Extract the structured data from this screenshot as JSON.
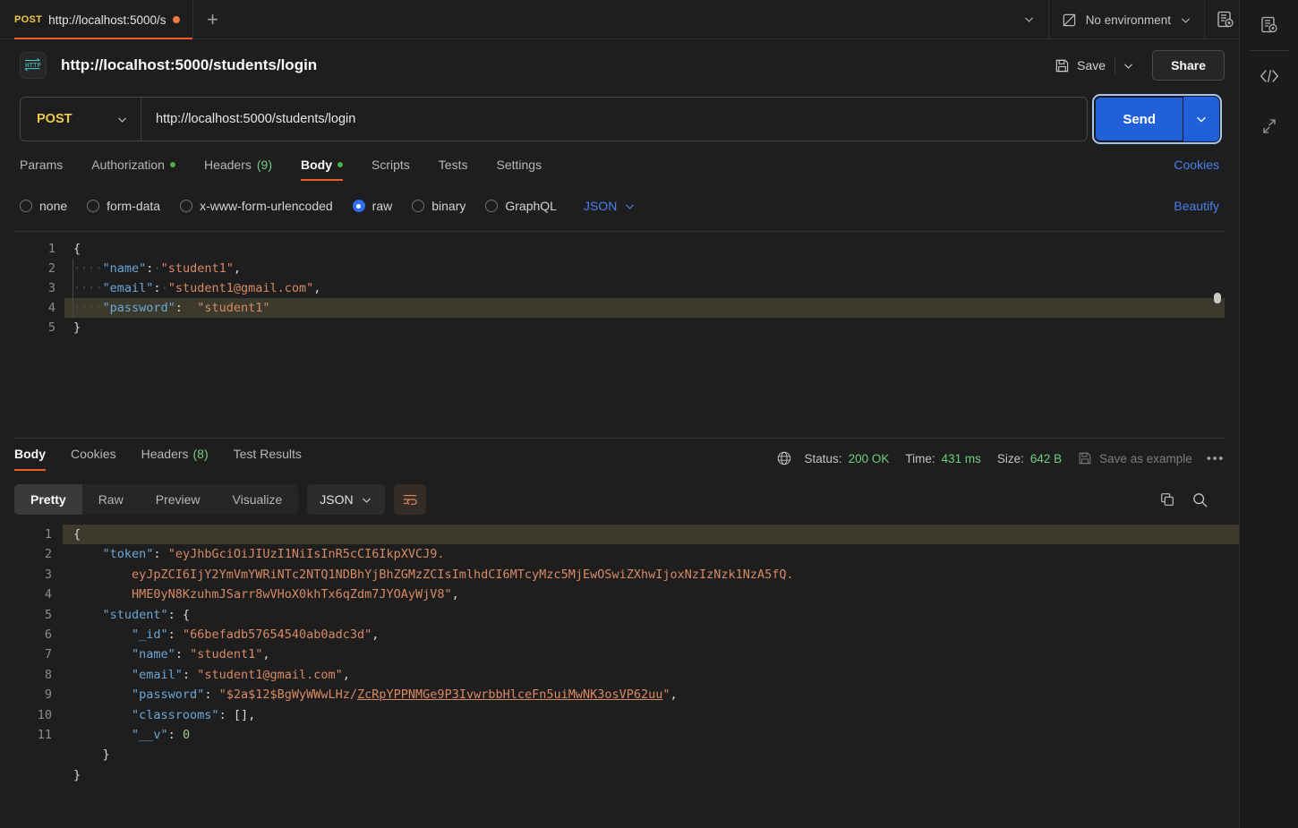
{
  "tabbar": {
    "tab_method": "POST",
    "tab_title": "http://localhost:5000/s",
    "plus": "+",
    "env_label": "No environment",
    "caret": "⌄"
  },
  "request_header": {
    "protocol_badge": "HTTP",
    "title": "http://localhost:5000/students/login",
    "save_label": "Save",
    "share_label": "Share"
  },
  "url_bar": {
    "method": "POST",
    "url": "http://localhost:5000/students/login",
    "send_label": "Send"
  },
  "request_tabs": {
    "items": [
      {
        "label": "Params",
        "dot": false,
        "count": ""
      },
      {
        "label": "Authorization",
        "dot": true,
        "count": ""
      },
      {
        "label": "Headers",
        "dot": false,
        "count": "(9)"
      },
      {
        "label": "Body",
        "dot": true,
        "count": ""
      },
      {
        "label": "Scripts",
        "dot": false,
        "count": ""
      },
      {
        "label": "Tests",
        "dot": false,
        "count": ""
      },
      {
        "label": "Settings",
        "dot": false,
        "count": ""
      }
    ],
    "active": "Body",
    "cookies_label": "Cookies"
  },
  "body_type": {
    "options": [
      "none",
      "form-data",
      "x-www-form-urlencoded",
      "raw",
      "binary",
      "GraphQL"
    ],
    "selected": "raw",
    "format": "JSON",
    "beautify_label": "Beautify"
  },
  "request_body": {
    "lines": [
      {
        "n": "1",
        "html": "{"
      },
      {
        "n": "2",
        "html": "····\"name\"· : ·\"student1\","
      },
      {
        "n": "3",
        "html": "····\"email\": ·\"student1@gmail.com\","
      },
      {
        "n": "4",
        "html": "····\"password\": ·\"student1\""
      },
      {
        "n": "5",
        "html": "}"
      }
    ],
    "active_line": 4
  },
  "response_tabs": {
    "items": [
      {
        "label": "Body",
        "count": ""
      },
      {
        "label": "Cookies",
        "count": ""
      },
      {
        "label": "Headers",
        "count": "(8)"
      },
      {
        "label": "Test Results",
        "count": ""
      }
    ],
    "active": "Body"
  },
  "response_meta": {
    "status_label": "Status:",
    "status_value": "200 OK",
    "time_label": "Time:",
    "time_value": "431 ms",
    "size_label": "Size:",
    "size_value": "642 B",
    "save_as_example": "Save as example",
    "more": "•••"
  },
  "response_toolbar": {
    "views": [
      "Pretty",
      "Raw",
      "Preview",
      "Visualize"
    ],
    "active_view": "Pretty",
    "format": "JSON"
  },
  "response_body": {
    "lines": [
      {
        "n": "1"
      },
      {
        "n": "2"
      },
      {
        "n": ""
      },
      {
        "n": ""
      },
      {
        "n": "3"
      },
      {
        "n": "4"
      },
      {
        "n": "5"
      },
      {
        "n": "6"
      },
      {
        "n": "7"
      },
      {
        "n": "8"
      },
      {
        "n": "9"
      },
      {
        "n": "10"
      },
      {
        "n": "11"
      }
    ],
    "token": "eyJhbGciOiJIUzI1NiIsInR5cCI6IkpXVCJ9.",
    "token_part2": "eyJpZCI6IjY2YmVmYWRiNTc2NTQ1NDBhYjBhZGMzZCIsImlhdCI6MTcyMzc5MjEwOSwiZXhwIjoxNzIzNzk1NzA5fQ.",
    "token_part3": "HME0yN8KzuhmJSarr8wVHoX0khTx6qZdm7JYOAyWjV8",
    "student_id": "66befadb57654540ab0adc3d",
    "student_name": "student1",
    "student_email": "student1@gmail.com",
    "password_plain": "$2a$12$BgWyWWwLHz/",
    "password_underlined": "ZcRpYPPNMGe9P3IvwrbbHlceFn5uiMwNK3osVP62uu",
    "classrooms": "[]",
    "__v": "0"
  },
  "colors": {
    "accent_orange": "#ef5b25",
    "send_blue": "#2260d9",
    "link_blue": "#4a7ff0",
    "status_green": "#6fcf7f",
    "method_yellow": "#efc94c",
    "string_orange": "#d98a63",
    "key_blue": "#6ba7d8"
  }
}
